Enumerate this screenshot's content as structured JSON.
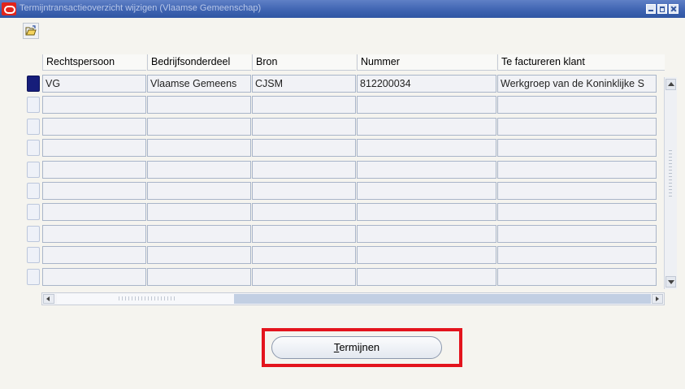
{
  "window": {
    "title": "Termijntransactieoverzicht wijzigen (Vlaamse Gemeenschap)"
  },
  "toolbar": {
    "open_icon": "folder-open-icon"
  },
  "table": {
    "columns": [
      {
        "label": "Rechtspersoon"
      },
      {
        "label": "Bedrijfsonderdeel"
      },
      {
        "label": "Bron"
      },
      {
        "label": "Nummer"
      },
      {
        "label": "Te factureren klant"
      }
    ],
    "rows": [
      [
        "VG",
        "Vlaamse Gemeens",
        "CJSM",
        "812200034",
        "Werkgroep van de Koninklijke S"
      ],
      [
        "",
        "",
        "",
        "",
        ""
      ],
      [
        "",
        "",
        "",
        "",
        ""
      ],
      [
        "",
        "",
        "",
        "",
        ""
      ],
      [
        "",
        "",
        "",
        "",
        ""
      ],
      [
        "",
        "",
        "",
        "",
        ""
      ],
      [
        "",
        "",
        "",
        "",
        ""
      ],
      [
        "",
        "",
        "",
        "",
        ""
      ],
      [
        "",
        "",
        "",
        "",
        ""
      ],
      [
        "",
        "",
        "",
        "",
        ""
      ]
    ]
  },
  "buttons": {
    "termijnen_mnemonic": "T",
    "termijnen_rest": "ermijnen"
  }
}
